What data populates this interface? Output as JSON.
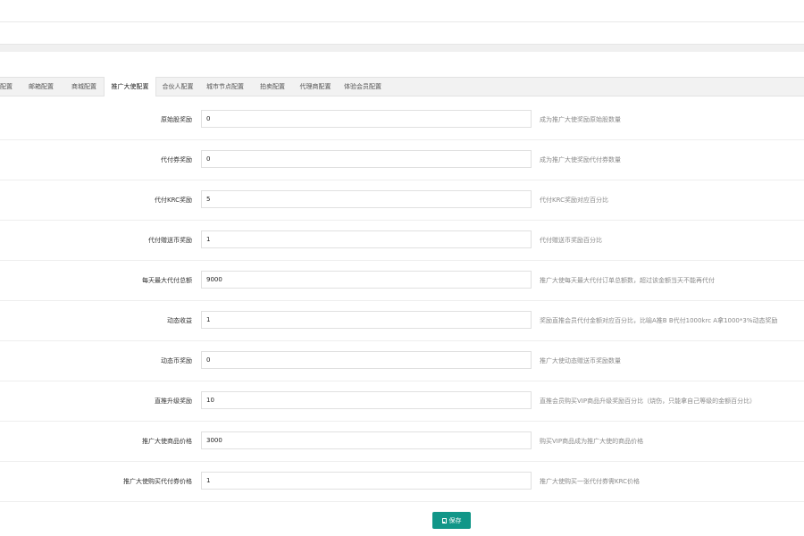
{
  "tabs": [
    {
      "label": "配置",
      "active": false
    },
    {
      "label": "邮箱配置",
      "active": false
    },
    {
      "label": "商城配置",
      "active": false
    },
    {
      "label": "推广大使配置",
      "active": true
    },
    {
      "label": "合伙人配置",
      "active": false
    },
    {
      "label": "城市节点配置",
      "active": false
    },
    {
      "label": "拍卖配置",
      "active": false
    },
    {
      "label": "代理商配置",
      "active": false
    },
    {
      "label": "体验会员配置",
      "active": false
    }
  ],
  "form": {
    "rows": [
      {
        "label": "原始股奖励",
        "value": "0",
        "hint": "成为推广大使奖励原始股数量"
      },
      {
        "label": "代付券奖励",
        "value": "0",
        "hint": "成为推广大使奖励代付券数量"
      },
      {
        "label": "代付KRC奖励",
        "value": "5",
        "hint": "代付KRC奖励对应百分比"
      },
      {
        "label": "代付赠送币奖励",
        "value": "1",
        "hint": "代付赠送币奖励百分比"
      },
      {
        "label": "每天最大代付总额",
        "value": "9000",
        "hint": "推广大使每天最大代付订单总额数，超过该金额当天不能再代付"
      },
      {
        "label": "动态收益",
        "value": "1",
        "hint": "奖励直推会员代付金额对应百分比，比喻A推B B代付1000krc A拿1000*3%动态奖励"
      },
      {
        "label": "动态币奖励",
        "value": "0",
        "hint": "推广大使动态赠送币奖励数量"
      },
      {
        "label": "直推升级奖励",
        "value": "10",
        "hint": "直推会员购买VIP商品升级奖励百分比（烧伤，只能拿自己等级的金额百分比）"
      },
      {
        "label": "推广大使商品价格",
        "value": "3000",
        "hint": "购买VIP商品成为推广大使的商品价格"
      },
      {
        "label": "推广大使购买代付券价格",
        "value": "1",
        "hint": "推广大使购买一张代付券需KRC价格"
      }
    ]
  },
  "actions": {
    "save_label": "保存",
    "save_icon": "save-icon",
    "accent_color": "#119688"
  }
}
